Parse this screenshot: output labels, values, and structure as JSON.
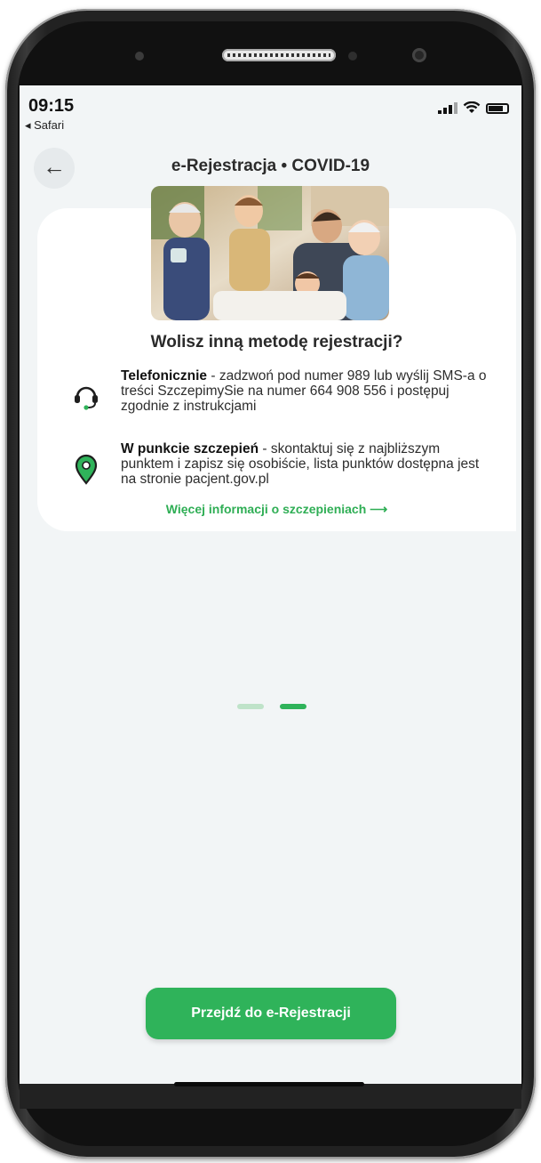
{
  "status_bar": {
    "time": "09:15",
    "back_app": "◂ Safari"
  },
  "header": {
    "title": "e-Rejestracja • COVID-19",
    "back_icon": "←"
  },
  "card": {
    "question": "Wolisz inną metodę rejestracji?",
    "options": [
      {
        "icon": "headset-icon",
        "bold": "Telefonicznie",
        "text": " - zadzwoń pod numer 989 lub wyślij SMS-a o treści SzczepimySie na numer 664 908 556 i postępuj zgodnie z instrukcjami"
      },
      {
        "icon": "location-pin-icon",
        "bold": "W punkcie szczepień",
        "text": " - skontaktuj się z najbliższym punktem i zapisz się osobiście, lista punktów dostępna jest na stronie pacjent.gov.pl"
      }
    ],
    "more_link": "Więcej informacji o szczepieniach  ⟶"
  },
  "pagination": {
    "total": 2,
    "active": 2
  },
  "cta": {
    "label": "Przejdź do e-Rejestracji"
  },
  "colors": {
    "accent": "#2fb35a",
    "link": "#2fae55",
    "dot_inactive": "#bfe3c9",
    "background": "#f2f5f6"
  }
}
